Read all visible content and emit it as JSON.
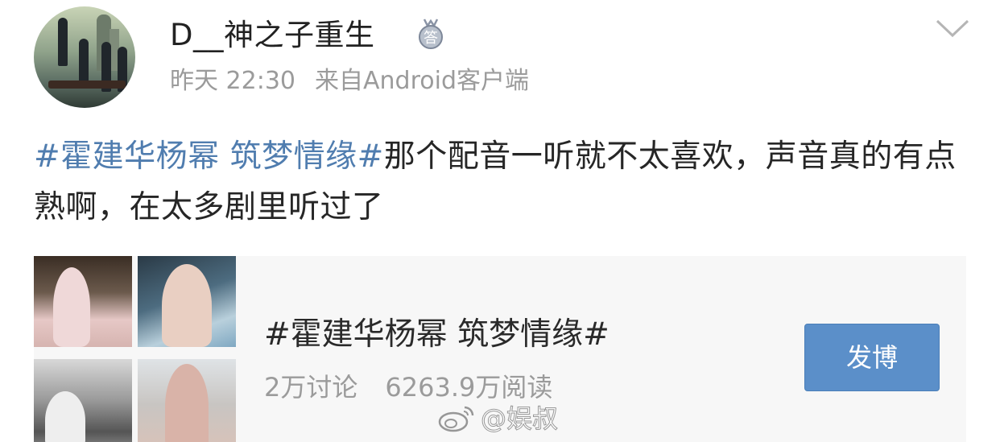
{
  "post": {
    "author": {
      "name": "D__神之子重生",
      "badge_icon": "answer-badge-icon"
    },
    "meta": {
      "time": "昨天 22:30",
      "source": "来自Android客户端"
    },
    "text": {
      "topic": "#霍建华杨幂 筑梦情缘#",
      "body": "那个配音一听就不太喜欢，声音真的有点熟啊，在太多剧里听过了"
    },
    "menu_icon": "chevron-down-icon"
  },
  "topic_card": {
    "title": "#霍建华杨幂 筑梦情缘#",
    "discussions": "2万讨论",
    "reads": "6263.9万阅读",
    "button_label": "发博"
  },
  "watermark": {
    "logo_icon": "weibo-logo-icon",
    "text": "@娱叔"
  },
  "colors": {
    "topic_link": "#507daf",
    "button": "#5b8fc9",
    "meta_text": "#9b9b9b",
    "card_bg": "#f7f7f7"
  }
}
